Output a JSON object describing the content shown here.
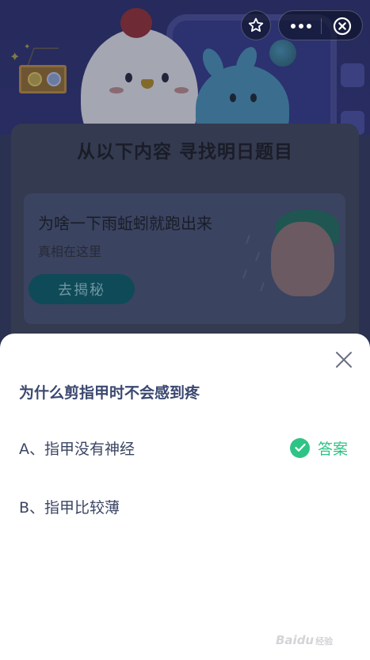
{
  "header": {
    "banner_title": "从以下内容 寻找明日题目"
  },
  "topic": {
    "title": "为啥一下雨蚯蚓就跑出来",
    "subtitle": "真相在这里",
    "button_label": "去揭秘"
  },
  "quiz": {
    "question": "为什么剪指甲时不会感到疼",
    "options": [
      {
        "label": "A、指甲没有神经",
        "is_answer": true
      },
      {
        "label": "B、指甲比较薄",
        "is_answer": false
      }
    ],
    "answer_label": "答案",
    "answer_color": "#2ec485"
  },
  "watermark": {
    "text": "Baidu",
    "suffix": "经验"
  },
  "icons": {
    "favorite": "star-outline-icon",
    "more": "more-dots-icon",
    "close_mini": "circle-close-icon",
    "sheet_close": "close-x-icon",
    "answer_check": "check-icon"
  }
}
